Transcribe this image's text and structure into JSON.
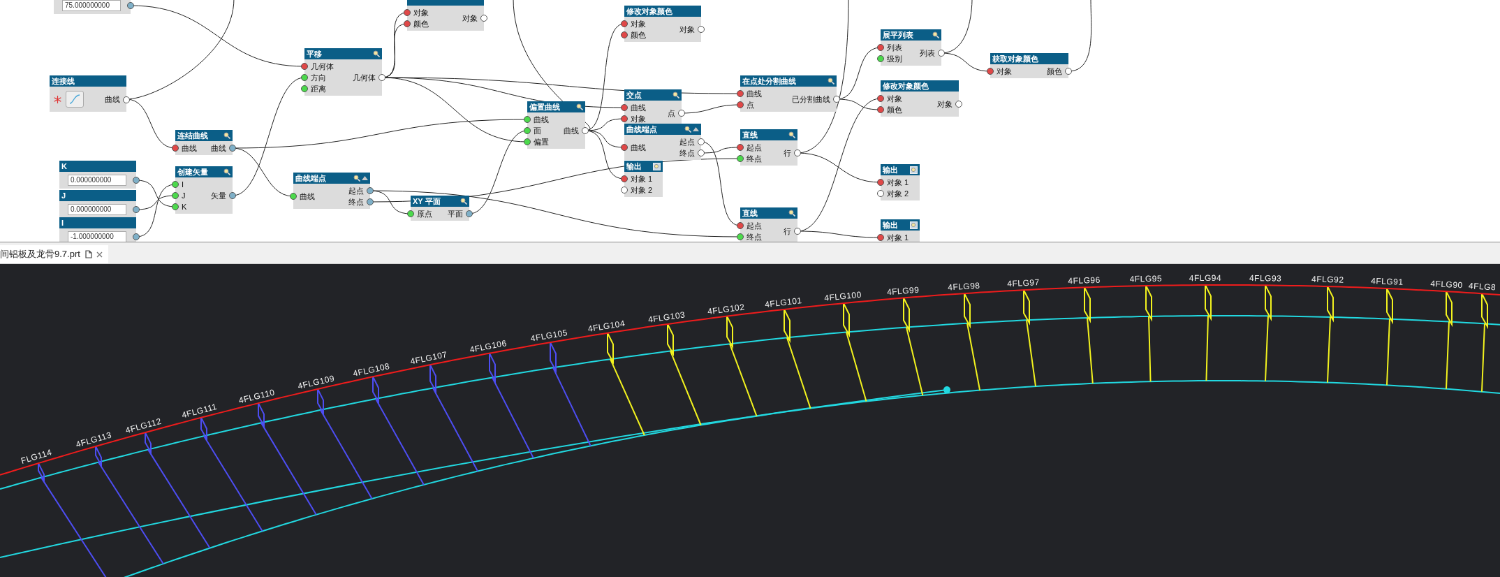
{
  "graph": {
    "nodes": [
      {
        "kind": "input",
        "field": "75.000000000",
        "outputs": [
          {
            "color": "#7fb0c8"
          }
        ]
      },
      {
        "kind": "plain",
        "inputs": [
          {
            "label": "对象",
            "color": "#e04848"
          },
          {
            "label": "颜色",
            "color": "#e04848"
          }
        ],
        "outputs": [
          {
            "label": "对象",
            "color": "#ffffff"
          }
        ]
      },
      {
        "kind": "plain",
        "title": "修改对象颜色",
        "inputs": [
          {
            "label": "对象",
            "color": "#e04848"
          },
          {
            "label": "颜色",
            "color": "#e04848"
          }
        ],
        "outputs": [
          {
            "label": "对象",
            "color": "#ffffff"
          }
        ]
      },
      {
        "kind": "function",
        "title": "平移",
        "inputs": [
          {
            "label": "几何体",
            "color": "#e04848"
          },
          {
            "label": "方向",
            "color": "#4cd94c"
          },
          {
            "label": "距离",
            "color": "#4cd94c"
          }
        ],
        "outputs": [
          {
            "label": "几何体",
            "color": "#ffffff"
          }
        ]
      },
      {
        "kind": "function",
        "title": "展平列表",
        "inputs": [
          {
            "label": "列表",
            "color": "#e04848"
          },
          {
            "label": "级别",
            "color": "#4cd94c"
          }
        ],
        "outputs": [
          {
            "label": "列表",
            "color": "#ffffff"
          }
        ]
      },
      {
        "kind": "plain",
        "title": "获取对象颜色",
        "inputs": [
          {
            "label": "对象",
            "color": "#e04848"
          }
        ],
        "outputs": [
          {
            "label": "颜色",
            "color": "#ffffff"
          }
        ]
      },
      {
        "kind": "selector",
        "title": "连接线",
        "outputs": [
          {
            "label": "曲线",
            "color": "#ffffff"
          }
        ]
      },
      {
        "kind": "function",
        "title": "在点处分割曲线",
        "inputs": [
          {
            "label": "曲线",
            "color": "#e04848"
          },
          {
            "label": "点",
            "color": "#e04848"
          }
        ],
        "outputs": [
          {
            "label": "已分割曲线",
            "color": "#ffffff"
          }
        ]
      },
      {
        "kind": "plain",
        "title": "修改对象颜色",
        "inputs": [
          {
            "label": "对象",
            "color": "#e04848"
          },
          {
            "label": "颜色",
            "color": "#e04848"
          }
        ],
        "outputs": [
          {
            "label": "对象",
            "color": "#ffffff"
          }
        ]
      },
      {
        "kind": "function",
        "title": "交点",
        "inputs": [
          {
            "label": "曲线",
            "color": "#e04848"
          },
          {
            "label": "对象",
            "color": "#e04848"
          }
        ],
        "outputs": [
          {
            "label": "点",
            "color": "#ffffff"
          }
        ]
      },
      {
        "kind": "function",
        "title": "偏置曲线",
        "inputs": [
          {
            "label": "曲线",
            "color": "#4cd94c"
          },
          {
            "label": "面",
            "color": "#4cd94c"
          },
          {
            "label": "偏置",
            "color": "#4cd94c"
          }
        ],
        "outputs": [
          {
            "label": "曲线",
            "color": "#ffffff"
          }
        ]
      },
      {
        "kind": "function",
        "title": "连结曲线",
        "inputs": [
          {
            "label": "曲线",
            "color": "#e04848"
          }
        ],
        "outputs": [
          {
            "label": "曲线",
            "color": "#7fb0c8"
          }
        ]
      },
      {
        "kind": "endpoint",
        "title": "曲线端点",
        "inputs": [
          {
            "label": "曲线",
            "color": "#e04848"
          }
        ],
        "outputs": [
          {
            "label": "起点",
            "color": "#ffffff"
          },
          {
            "label": "终点",
            "color": "#ffffff"
          }
        ]
      },
      {
        "kind": "function",
        "title": "直线",
        "inputs": [
          {
            "label": "起点",
            "color": "#e04848"
          },
          {
            "label": "终点",
            "color": "#4cd94c"
          }
        ],
        "outputs": [
          {
            "label": "行",
            "color": "#ffffff"
          }
        ]
      },
      {
        "kind": "input",
        "title": "K",
        "field": "0.000000000",
        "outputs": [
          {
            "color": "#7fb0c8"
          }
        ]
      },
      {
        "kind": "output",
        "title": "输出",
        "inputs": [
          {
            "label": "对象 1",
            "color": "#e04848"
          },
          {
            "label": "对象 2",
            "color": "#ffffff"
          }
        ]
      },
      {
        "kind": "function",
        "title": "创建矢量",
        "inputs": [
          {
            "label": "I",
            "color": "#4cd94c"
          },
          {
            "label": "J",
            "color": "#4cd94c"
          },
          {
            "label": "K",
            "color": "#4cd94c"
          }
        ],
        "outputs": [
          {
            "label": "矢量",
            "color": "#7fb0c8"
          }
        ]
      },
      {
        "kind": "endpoint",
        "title": "曲线端点",
        "inputs": [
          {
            "label": "曲线",
            "color": "#4cd94c"
          }
        ],
        "outputs": [
          {
            "label": "起点",
            "color": "#7fb0c8"
          },
          {
            "label": "终点",
            "color": "#7fb0c8"
          }
        ]
      },
      {
        "kind": "output",
        "title": "输出",
        "inputs": [
          {
            "label": "对象 1",
            "color": "#e04848"
          },
          {
            "label": "对象 2",
            "color": "#ffffff"
          }
        ]
      },
      {
        "kind": "input",
        "title": "J",
        "field": "0.000000000",
        "outputs": [
          {
            "color": "#7fb0c8"
          }
        ]
      },
      {
        "kind": "function",
        "title": "XY 平面",
        "inputs": [
          {
            "label": "原点",
            "color": "#4cd94c"
          }
        ],
        "outputs": [
          {
            "label": "平面",
            "color": "#7fb0c8"
          }
        ]
      },
      {
        "kind": "input",
        "title": "I",
        "field": "-1.000000000",
        "outputs": [
          {
            "color": "#7fb0c8"
          }
        ]
      },
      {
        "kind": "function",
        "title": "直线",
        "inputs": [
          {
            "label": "起点",
            "color": "#e04848"
          },
          {
            "label": "终点",
            "color": "#4cd94c"
          }
        ],
        "outputs": [
          {
            "label": "行",
            "color": "#ffffff"
          }
        ]
      },
      {
        "kind": "output",
        "title": "输出",
        "inputs": [
          {
            "label": "对象 1",
            "color": "#e04848"
          }
        ]
      }
    ]
  },
  "file_tab": {
    "label": "间铝板及龙骨9.7.prt"
  },
  "viewport": {
    "labels": [
      "FLG114",
      "4FLG113",
      "4FLG112",
      "4FLG111",
      "4FLG110",
      "4FLG109",
      "4FLG108",
      "4FLG107",
      "4FLG106",
      "4FLG105",
      "4FLG104",
      "4FLG103",
      "4FLG102",
      "4FLG101",
      "4FLG100",
      "4FLG99",
      "4FLG98",
      "4FLG97",
      "4FLG96",
      "4FLG95",
      "4FLG94",
      "4FLG93",
      "4FLG92",
      "4FLG91",
      "4FLG90",
      "4FLG8"
    ]
  }
}
